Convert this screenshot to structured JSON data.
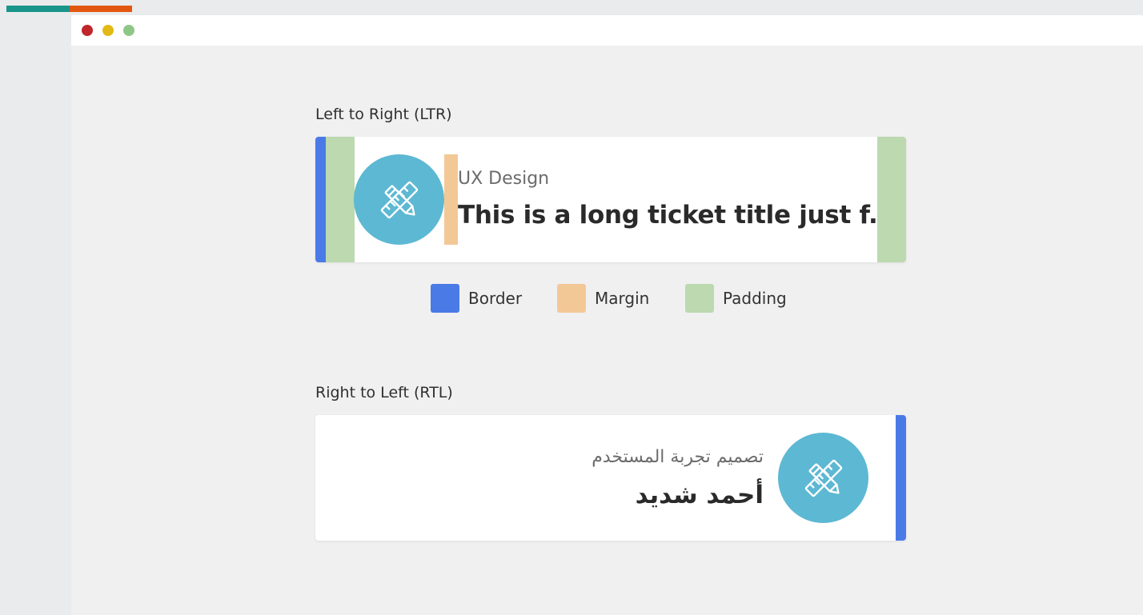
{
  "colors": {
    "accent_teal": "#19958a",
    "accent_orange": "#e2570f",
    "border": "#4a7ae6",
    "margin": "#f3c897",
    "padding": "#bcd9b0",
    "avatar": "#5db8d3",
    "window_close": "#c0272d",
    "window_minimize": "#e3ba15",
    "window_maximize": "#8ec785"
  },
  "ltr_section": {
    "heading": "Left to Right (LTR)",
    "card": {
      "icon": "pencil-ruler-icon",
      "category": "UX Design",
      "title": "This is a long ticket title just f...."
    }
  },
  "legend": {
    "items": [
      {
        "label": "Border",
        "color": "#4a7ae6"
      },
      {
        "label": "Margin",
        "color": "#f3c897"
      },
      {
        "label": "Padding",
        "color": "#bcd9b0"
      }
    ]
  },
  "rtl_section": {
    "heading": "Right to Left (RTL)",
    "card": {
      "icon": "pencil-ruler-icon",
      "category": "تصميم تجربة المستخدم",
      "title": "أحمد شديد"
    }
  }
}
